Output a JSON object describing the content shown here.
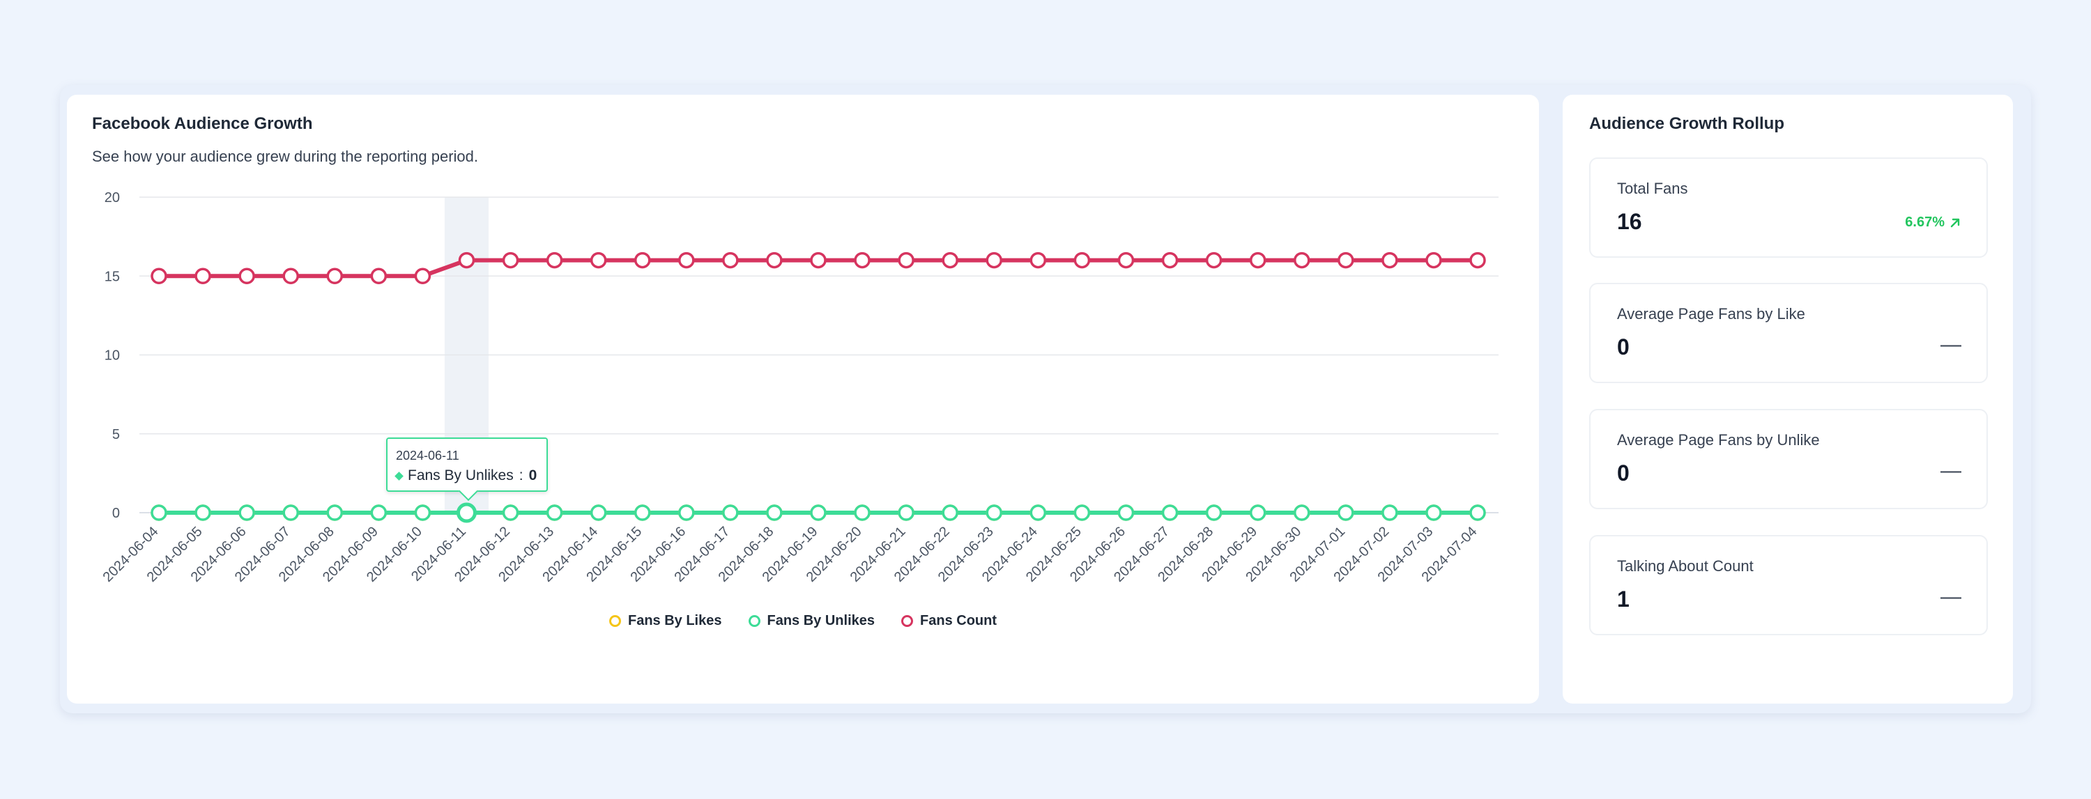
{
  "chart_panel": {
    "title": "Facebook Audience Growth",
    "subtitle": "See how your audience grew during the reporting period."
  },
  "rollup_panel": {
    "title": "Audience Growth Rollup",
    "stats": [
      {
        "label": "Total Fans",
        "value": "16",
        "change": "6.67%",
        "change_icon": "arrow-up-right-icon"
      },
      {
        "label": "Average Page Fans by Like",
        "value": "0",
        "change": "—"
      },
      {
        "label": "Average Page Fans by Unlike",
        "value": "0",
        "change": "—"
      },
      {
        "label": "Talking About Count",
        "value": "1",
        "change": "—"
      }
    ]
  },
  "tooltip": {
    "date": "2024-06-11",
    "series": "Fans By Unlikes",
    "value": "0"
  },
  "colors": {
    "likes": "#f5c518",
    "unlikes": "#3ddc97",
    "fans": "#d6345f",
    "highlight": "#eef2f7"
  },
  "chart_data": {
    "type": "line",
    "x": [
      "2024-06-04",
      "2024-06-05",
      "2024-06-06",
      "2024-06-07",
      "2024-06-08",
      "2024-06-09",
      "2024-06-10",
      "2024-06-11",
      "2024-06-12",
      "2024-06-13",
      "2024-06-14",
      "2024-06-15",
      "2024-06-16",
      "2024-06-17",
      "2024-06-18",
      "2024-06-19",
      "2024-06-20",
      "2024-06-21",
      "2024-06-22",
      "2024-06-23",
      "2024-06-24",
      "2024-06-25",
      "2024-06-26",
      "2024-06-27",
      "2024-06-28",
      "2024-06-29",
      "2024-06-30",
      "2024-07-01",
      "2024-07-02",
      "2024-07-03",
      "2024-07-04"
    ],
    "ylim": [
      0,
      20
    ],
    "yticks": [
      0,
      5,
      10,
      15,
      20
    ],
    "grid": true,
    "legend_position": "bottom",
    "highlight_index": 7,
    "series": [
      {
        "name": "Fans By Likes",
        "values": [
          0,
          0,
          0,
          0,
          0,
          0,
          0,
          0,
          0,
          0,
          0,
          0,
          0,
          0,
          0,
          0,
          0,
          0,
          0,
          0,
          0,
          0,
          0,
          0,
          0,
          0,
          0,
          0,
          0,
          0,
          0
        ]
      },
      {
        "name": "Fans By Unlikes",
        "values": [
          0,
          0,
          0,
          0,
          0,
          0,
          0,
          0,
          0,
          0,
          0,
          0,
          0,
          0,
          0,
          0,
          0,
          0,
          0,
          0,
          0,
          0,
          0,
          0,
          0,
          0,
          0,
          0,
          0,
          0,
          0
        ]
      },
      {
        "name": "Fans Count",
        "values": [
          15,
          15,
          15,
          15,
          15,
          15,
          15,
          16,
          16,
          16,
          16,
          16,
          16,
          16,
          16,
          16,
          16,
          16,
          16,
          16,
          16,
          16,
          16,
          16,
          16,
          16,
          16,
          16,
          16,
          16,
          16
        ]
      }
    ]
  }
}
